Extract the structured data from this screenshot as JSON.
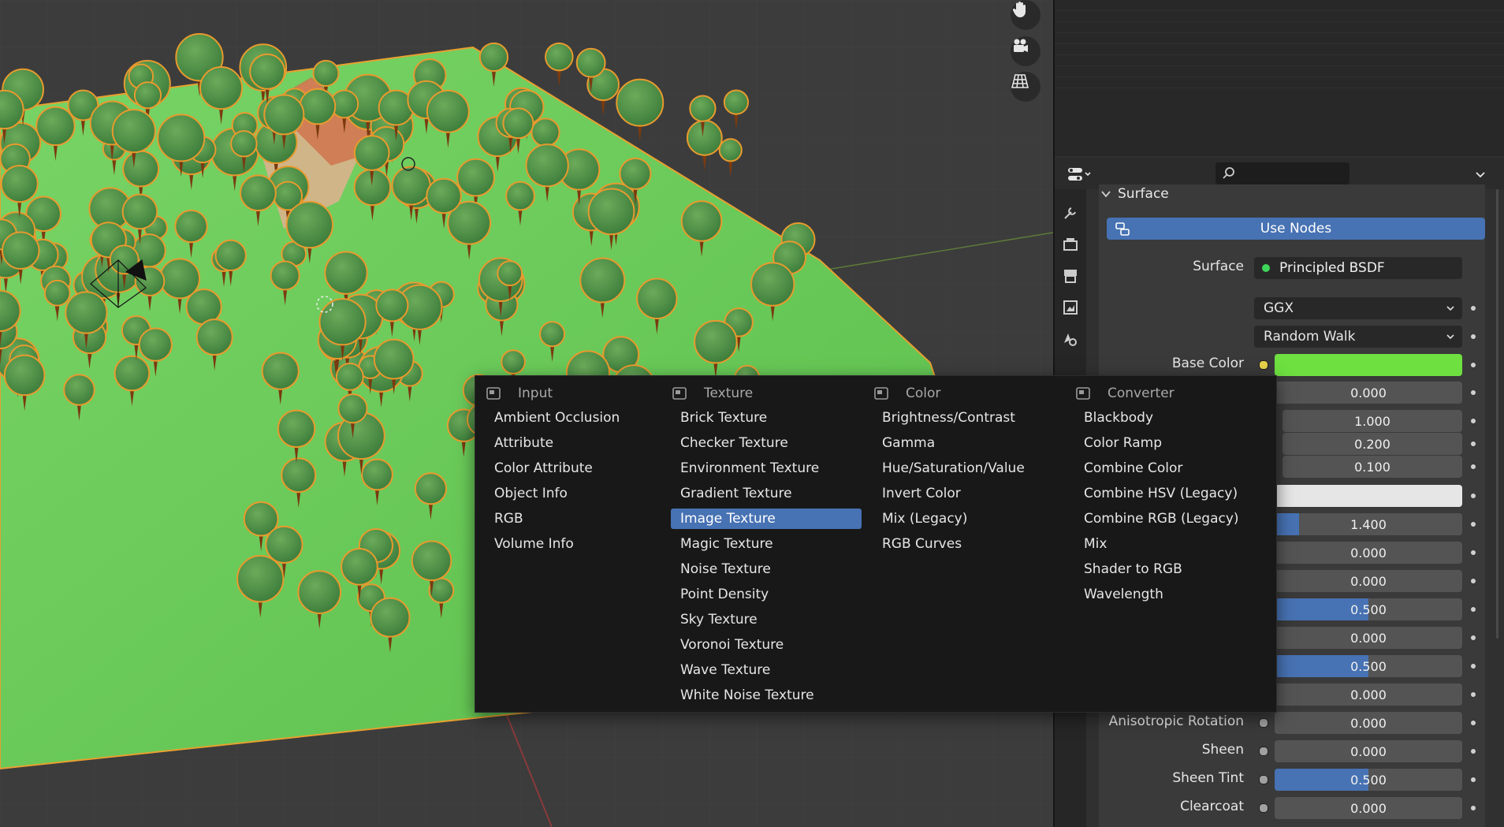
{
  "colors": {
    "accent": "#4772b3",
    "base_color": "#6ee040",
    "sheen_swatch": "#e6e6e6"
  },
  "viewport_tools": [
    "hand-icon",
    "camera-icon",
    "grid-icon"
  ],
  "properties": {
    "search": {
      "placeholder": ""
    },
    "panel_title": "Surface",
    "use_nodes": "Use Nodes",
    "surface": {
      "label": "Surface",
      "value": "Principled BSDF"
    },
    "distribution": "GGX",
    "subsurface_method": "Random Walk",
    "base_color": {
      "label": "Base Color"
    },
    "fields": [
      {
        "value": "0.000",
        "fraction": 0
      },
      {
        "value": "1.000",
        "fraction": 0
      },
      {
        "value": "0.200",
        "fraction": 0
      },
      {
        "value": "0.100",
        "fraction": 0
      },
      {
        "value": "",
        "fraction": 0
      },
      {
        "value": "1.400",
        "fraction": 0.13
      },
      {
        "value": "0.000",
        "fraction": 0
      },
      {
        "value": "0.000",
        "fraction": 0
      },
      {
        "value": "0.500",
        "fraction": 0.5
      },
      {
        "value": "0.000",
        "fraction": 0
      },
      {
        "value": "0.500",
        "fraction": 0.5
      },
      {
        "value": "0.000",
        "fraction": 0
      }
    ],
    "rows": [
      {
        "label": "Anisotropic Rotation",
        "value": "0.000",
        "fraction": 0
      },
      {
        "label": "Sheen",
        "value": "0.000",
        "fraction": 0
      },
      {
        "label": "Sheen Tint",
        "value": "0.500",
        "fraction": 0.5
      },
      {
        "label": "Clearcoat",
        "value": "0.000",
        "fraction": 0
      }
    ]
  },
  "menu": {
    "columns": [
      {
        "title": "Input",
        "items": [
          "Ambient Occlusion",
          "Attribute",
          "Color Attribute",
          "Object Info",
          "RGB",
          "Volume Info"
        ]
      },
      {
        "title": "Texture",
        "items": [
          "Brick Texture",
          "Checker Texture",
          "Environment Texture",
          "Gradient Texture",
          "Image Texture",
          "Magic Texture",
          "Noise Texture",
          "Point Density",
          "Sky Texture",
          "Voronoi Texture",
          "Wave Texture",
          "White Noise Texture"
        ],
        "active": "Image Texture"
      },
      {
        "title": "Color",
        "items": [
          "Brightness/Contrast",
          "Gamma",
          "Hue/Saturation/Value",
          "Invert Color",
          "Mix (Legacy)",
          "RGB Curves"
        ]
      },
      {
        "title": "Converter",
        "items": [
          "Blackbody",
          "Color Ramp",
          "Combine Color",
          "Combine HSV (Legacy)",
          "Combine RGB (Legacy)",
          "Mix",
          "Shader to RGB",
          "Wavelength"
        ]
      }
    ]
  }
}
